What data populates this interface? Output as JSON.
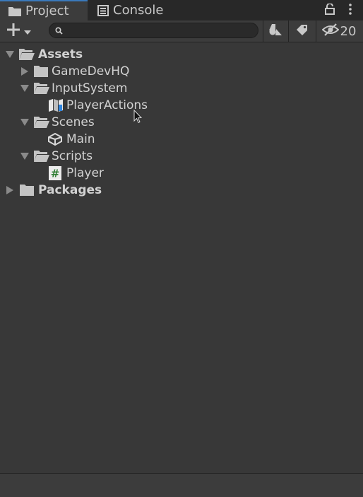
{
  "tabs": [
    {
      "label": "Project",
      "icon": "folder-icon",
      "active": true
    },
    {
      "label": "Console",
      "icon": "console-icon",
      "active": false
    }
  ],
  "window_controls": {
    "lock": "lock-icon",
    "more": "kebab-menu-icon"
  },
  "toolbar": {
    "add_icon": "plus-icon",
    "search_placeholder": "",
    "search_value": "",
    "hidden_count": "20"
  },
  "tree": [
    {
      "label": "Assets",
      "bold": true,
      "expanded": true,
      "depth": 0,
      "type": "folder"
    },
    {
      "label": "GameDevHQ",
      "bold": false,
      "expanded": false,
      "depth": 1,
      "type": "folder"
    },
    {
      "label": "InputSystem",
      "bold": false,
      "expanded": true,
      "depth": 1,
      "type": "folder"
    },
    {
      "label": "PlayerActions",
      "bold": false,
      "depth": 2,
      "type": "input-actions"
    },
    {
      "label": "Scenes",
      "bold": false,
      "expanded": true,
      "depth": 1,
      "type": "folder"
    },
    {
      "label": "Main",
      "bold": false,
      "depth": 2,
      "type": "scene"
    },
    {
      "label": "Scripts",
      "bold": false,
      "expanded": true,
      "depth": 1,
      "type": "folder"
    },
    {
      "label": "Player",
      "bold": false,
      "depth": 2,
      "type": "script"
    },
    {
      "label": "Packages",
      "bold": true,
      "expanded": false,
      "depth": 0,
      "type": "folder"
    }
  ],
  "colors": {
    "accent": "#3a79bb",
    "panel_bg": "#383838",
    "tab_bg": "#282828",
    "text": "#d2d2d2"
  }
}
